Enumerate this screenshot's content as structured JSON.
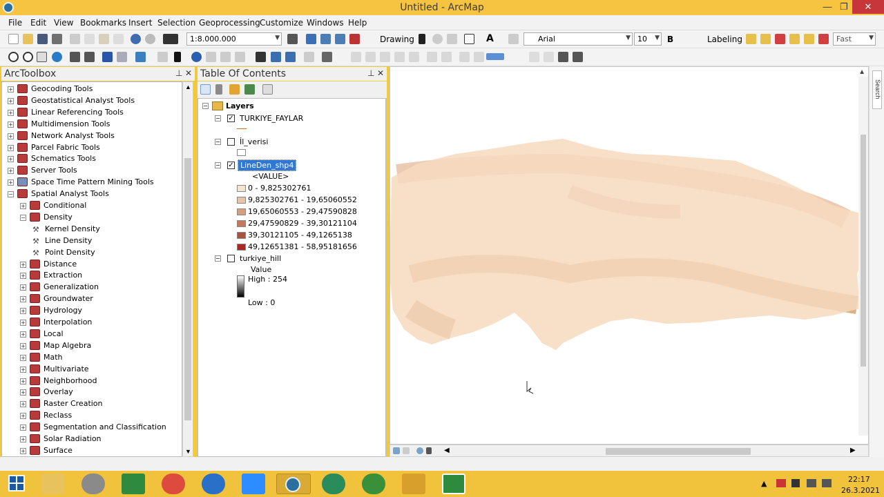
{
  "window": {
    "title": "Untitled - ArcMap",
    "minimize": "—",
    "maximize": "❐",
    "close": "✕"
  },
  "menu": [
    "File",
    "Edit",
    "View",
    "Bookmarks",
    "Insert",
    "Selection",
    "Geoprocessing",
    "Customize",
    "Windows",
    "Help"
  ],
  "toolbar": {
    "scale": "1:8.000.000",
    "drawing_label": "Drawing",
    "font_name": "Arial",
    "font_size": "10",
    "bold_label": "B",
    "labeling_label": "Labeling",
    "quality": "Fast"
  },
  "arctoolbox": {
    "title": "ArcToolbox",
    "pin": "⊥",
    "close": "✕",
    "items": [
      {
        "label": "Geocoding Tools",
        "level": 0,
        "kind": "toolbox",
        "expanded": false
      },
      {
        "label": "Geostatistical Analyst Tools",
        "level": 0,
        "kind": "toolbox",
        "expanded": false
      },
      {
        "label": "Linear Referencing Tools",
        "level": 0,
        "kind": "toolbox",
        "expanded": false
      },
      {
        "label": "Multidimension Tools",
        "level": 0,
        "kind": "toolbox",
        "expanded": false
      },
      {
        "label": "Network Analyst Tools",
        "level": 0,
        "kind": "toolbox",
        "expanded": false
      },
      {
        "label": "Parcel Fabric Tools",
        "level": 0,
        "kind": "toolbox",
        "expanded": false
      },
      {
        "label": "Schematics Tools",
        "level": 0,
        "kind": "toolbox",
        "expanded": false
      },
      {
        "label": "Server Tools",
        "level": 0,
        "kind": "toolbox",
        "expanded": false
      },
      {
        "label": "Space Time Pattern Mining Tools",
        "level": 0,
        "kind": "toolbox",
        "expanded": false
      },
      {
        "label": "Spatial Analyst Tools",
        "level": 0,
        "kind": "toolbox",
        "expanded": true
      },
      {
        "label": "Conditional",
        "level": 1,
        "kind": "toolset",
        "expanded": false
      },
      {
        "label": "Density",
        "level": 1,
        "kind": "toolset",
        "expanded": true
      },
      {
        "label": "Kernel Density",
        "level": 2,
        "kind": "tool"
      },
      {
        "label": "Line Density",
        "level": 2,
        "kind": "tool"
      },
      {
        "label": "Point Density",
        "level": 2,
        "kind": "tool"
      },
      {
        "label": "Distance",
        "level": 1,
        "kind": "toolset",
        "expanded": false
      },
      {
        "label": "Extraction",
        "level": 1,
        "kind": "toolset",
        "expanded": false
      },
      {
        "label": "Generalization",
        "level": 1,
        "kind": "toolset",
        "expanded": false
      },
      {
        "label": "Groundwater",
        "level": 1,
        "kind": "toolset",
        "expanded": false
      },
      {
        "label": "Hydrology",
        "level": 1,
        "kind": "toolset",
        "expanded": false
      },
      {
        "label": "Interpolation",
        "level": 1,
        "kind": "toolset",
        "expanded": false
      },
      {
        "label": "Local",
        "level": 1,
        "kind": "toolset",
        "expanded": false
      },
      {
        "label": "Map Algebra",
        "level": 1,
        "kind": "toolset",
        "expanded": false
      },
      {
        "label": "Math",
        "level": 1,
        "kind": "toolset",
        "expanded": false
      },
      {
        "label": "Multivariate",
        "level": 1,
        "kind": "toolset",
        "expanded": false
      },
      {
        "label": "Neighborhood",
        "level": 1,
        "kind": "toolset",
        "expanded": false
      },
      {
        "label": "Overlay",
        "level": 1,
        "kind": "toolset",
        "expanded": false
      },
      {
        "label": "Raster Creation",
        "level": 1,
        "kind": "toolset",
        "expanded": false
      },
      {
        "label": "Reclass",
        "level": 1,
        "kind": "toolset",
        "expanded": false
      },
      {
        "label": "Segmentation and Classification",
        "level": 1,
        "kind": "toolset",
        "expanded": false
      },
      {
        "label": "Solar Radiation",
        "level": 1,
        "kind": "toolset",
        "expanded": false
      },
      {
        "label": "Surface",
        "level": 1,
        "kind": "toolset",
        "expanded": false
      }
    ]
  },
  "toc": {
    "title": "Table Of Contents",
    "root": "Layers",
    "layers": [
      {
        "name": "TURKIYE_FAYLAR",
        "checked": true
      },
      {
        "name": "İl_verisi",
        "checked": false
      },
      {
        "name": "LineDen_shp4",
        "checked": true,
        "field": "<VALUE>"
      },
      {
        "name": "turkiye_hill",
        "checked": false,
        "field": "Value",
        "high": "High : 254",
        "low": "Low : 0"
      }
    ],
    "classes": [
      {
        "label": "0 - 9,825302761",
        "color": "#f4e4d4"
      },
      {
        "label": "9,825302761 - 19,65060552",
        "color": "#e6c4aa"
      },
      {
        "label": "19,65060553 - 29,47590828",
        "color": "#d39e80"
      },
      {
        "label": "29,47590829 - 39,30121104",
        "color": "#c07a60"
      },
      {
        "label": "39,30121105 - 49,1265138",
        "color": "#a95442"
      },
      {
        "label": "49,12651381 - 58,95181656",
        "color": "#a52a24"
      }
    ]
  },
  "search_tab": "Search",
  "clock": {
    "time": "22:17",
    "date": "26.3.2021"
  },
  "colors": {
    "map_fill": "#f7dfc7",
    "density_high": "#b8651e",
    "accent": "#f1c23c"
  }
}
